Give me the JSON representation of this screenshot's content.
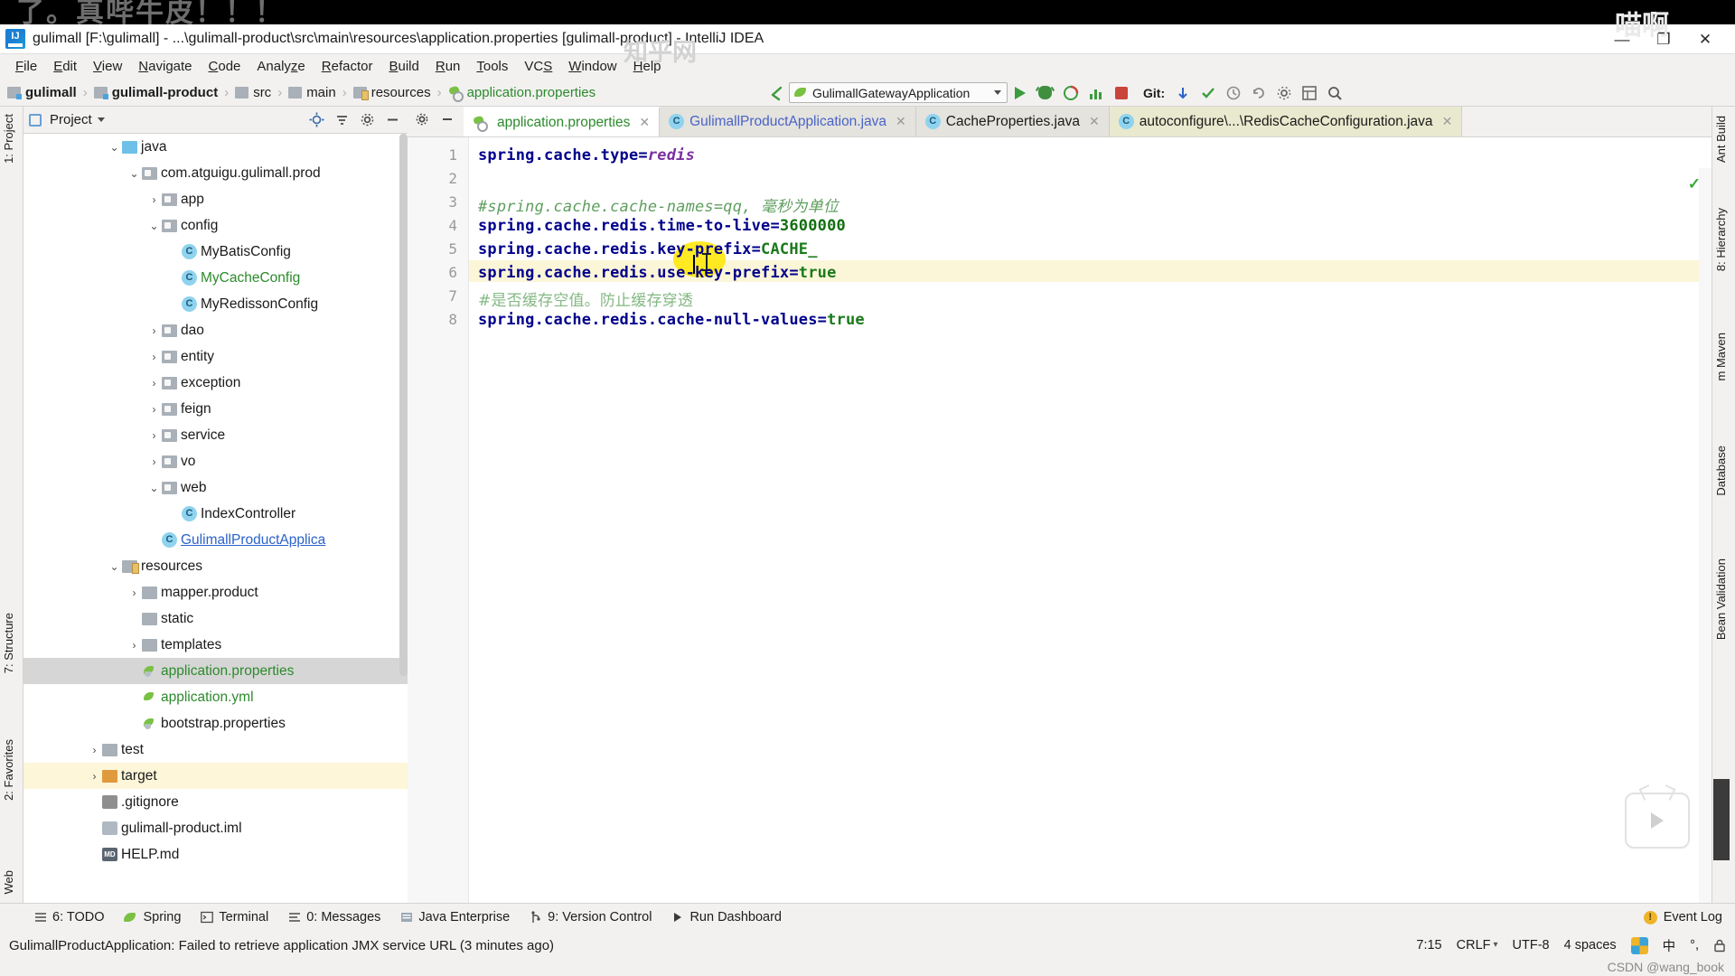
{
  "watermarks": {
    "top_left": "了。真哔牛皮！！！",
    "top_right": "喵啊",
    "mid": "知乎网",
    "csdn": "CSDN @wang_book"
  },
  "titlebar": {
    "title": "gulimall [F:\\gulimall] - ...\\gulimall-product\\src\\main\\resources\\application.properties [gulimall-product] - IntelliJ IDEA",
    "minimize": "—",
    "maximize": "❐",
    "close": "✕"
  },
  "menubar": {
    "items": [
      "File",
      "Edit",
      "View",
      "Navigate",
      "Code",
      "Analyze",
      "Refactor",
      "Build",
      "Run",
      "Tools",
      "VCS",
      "Window",
      "Help"
    ]
  },
  "breadcrumb": [
    {
      "label": "gulimall",
      "icon": "module-folder-icon",
      "bold": true
    },
    {
      "label": "gulimall-product",
      "icon": "module-folder-icon",
      "bold": true
    },
    {
      "label": "src",
      "icon": "folder-icon",
      "bold": false
    },
    {
      "label": "main",
      "icon": "folder-icon",
      "bold": false
    },
    {
      "label": "resources",
      "icon": "resources-folder-icon",
      "bold": false
    },
    {
      "label": "application.properties",
      "icon": "properties-file-icon",
      "bold": false,
      "green": true
    }
  ],
  "toolbar": {
    "run_config": "GulimallGatewayApplication",
    "git_label": "Git:",
    "icons": [
      "back-arrow-icon",
      "run-icon",
      "debug-icon",
      "run-coverage-icon",
      "profiler-icon",
      "stop-icon",
      "update-project-icon",
      "commit-icon",
      "history-icon",
      "revert-icon",
      "settings-icon",
      "project-structure-icon",
      "search-everywhere-icon"
    ]
  },
  "left_tool_strip": [
    {
      "label": "1: Project"
    },
    {
      "label": "2: Favorites"
    },
    {
      "label": "7: Structure"
    },
    {
      "label": "Web"
    }
  ],
  "right_tool_strip": [
    {
      "label": "Ant Build"
    },
    {
      "label": "8: Hierarchy"
    },
    {
      "label": "m  Maven"
    },
    {
      "label": "Database"
    },
    {
      "label": "Bean Validation"
    }
  ],
  "project_panel": {
    "title": "Project",
    "header_icons": [
      "project-select-icon",
      "chevron-down-icon",
      "locate-icon",
      "collapse-all-icon",
      "gear-icon",
      "hide-icon"
    ],
    "tree": [
      {
        "indent": 4,
        "arrow": "v",
        "icon": "folder-blue",
        "label": "java"
      },
      {
        "indent": 5,
        "arrow": "v",
        "icon": "package",
        "label": "com.atguigu.gulimall.prod"
      },
      {
        "indent": 6,
        "arrow": ">",
        "icon": "package",
        "label": "app"
      },
      {
        "indent": 6,
        "arrow": "v",
        "icon": "package",
        "label": "config"
      },
      {
        "indent": 7,
        "arrow": "",
        "icon": "class",
        "label": "MyBatisConfig"
      },
      {
        "indent": 7,
        "arrow": "",
        "icon": "class",
        "label": "MyCacheConfig",
        "color": "green"
      },
      {
        "indent": 7,
        "arrow": "",
        "icon": "class",
        "label": "MyRedissonConfig"
      },
      {
        "indent": 6,
        "arrow": ">",
        "icon": "package",
        "label": "dao"
      },
      {
        "indent": 6,
        "arrow": ">",
        "icon": "package",
        "label": "entity"
      },
      {
        "indent": 6,
        "arrow": ">",
        "icon": "package",
        "label": "exception"
      },
      {
        "indent": 6,
        "arrow": ">",
        "icon": "package",
        "label": "feign"
      },
      {
        "indent": 6,
        "arrow": ">",
        "icon": "package",
        "label": "service"
      },
      {
        "indent": 6,
        "arrow": ">",
        "icon": "package",
        "label": "vo"
      },
      {
        "indent": 6,
        "arrow": "v",
        "icon": "package",
        "label": "web"
      },
      {
        "indent": 7,
        "arrow": "",
        "icon": "class",
        "label": "IndexController"
      },
      {
        "indent": 6,
        "arrow": "",
        "icon": "spring-class",
        "label": "GulimallProductApplica",
        "color": "blue-u"
      },
      {
        "indent": 4,
        "arrow": "v",
        "icon": "folder-res",
        "label": "resources"
      },
      {
        "indent": 5,
        "arrow": ">",
        "icon": "folder",
        "label": "mapper.product"
      },
      {
        "indent": 5,
        "arrow": "",
        "icon": "folder",
        "label": "static"
      },
      {
        "indent": 5,
        "arrow": ">",
        "icon": "folder",
        "label": "templates"
      },
      {
        "indent": 5,
        "arrow": "",
        "icon": "properties-file",
        "label": "application.properties",
        "color": "green",
        "selected": true
      },
      {
        "indent": 5,
        "arrow": "",
        "icon": "yml-file",
        "label": "application.yml",
        "color": "green"
      },
      {
        "indent": 5,
        "arrow": "",
        "icon": "properties-file",
        "label": "bootstrap.properties"
      },
      {
        "indent": 3,
        "arrow": ">",
        "icon": "folder",
        "label": "test"
      },
      {
        "indent": 3,
        "arrow": ">",
        "icon": "folder-orange",
        "label": "target",
        "highlight": true
      },
      {
        "indent": 3,
        "arrow": "",
        "icon": "gitignore-file",
        "label": ".gitignore"
      },
      {
        "indent": 3,
        "arrow": "",
        "icon": "iml-file",
        "label": "gulimall-product.iml"
      },
      {
        "indent": 3,
        "arrow": "",
        "icon": "md-file",
        "label": "HELP.md"
      }
    ]
  },
  "editor": {
    "tabs": [
      {
        "label": "application.properties",
        "icon": "properties-file-icon",
        "active": true,
        "color": "green"
      },
      {
        "label": "GulimallProductApplication.java",
        "icon": "spring-class-icon",
        "active": false,
        "color": "blue"
      },
      {
        "label": "CacheProperties.java",
        "icon": "class-icon",
        "active": false,
        "color": "normal"
      },
      {
        "label": "autoconfigure\\...\\RedisCacheConfiguration.java",
        "icon": "class-icon",
        "active": false,
        "color": "normal",
        "olive": true
      }
    ],
    "line_numbers": [
      "1",
      "2",
      "3",
      "4",
      "5",
      "6",
      "7",
      "8"
    ],
    "lines": [
      {
        "n": 1,
        "segments": [
          {
            "t": "spring.cache.type=",
            "c": "k"
          },
          {
            "t": "redis",
            "c": "v-ital"
          }
        ]
      },
      {
        "n": 2,
        "segments": []
      },
      {
        "n": 3,
        "segments": [
          {
            "t": "#spring.cache.cache-names=qq, 毫秒为单位",
            "c": "cmt"
          }
        ]
      },
      {
        "n": 4,
        "segments": [
          {
            "t": "spring.cache.redis.time-to-live=",
            "c": "k"
          },
          {
            "t": "3600000",
            "c": "num"
          }
        ]
      },
      {
        "n": 5,
        "segments": [
          {
            "t": "spring.cache.redis.key-prefix=",
            "c": "k"
          },
          {
            "t": "CACHE_",
            "c": "strv"
          }
        ]
      },
      {
        "n": 6,
        "segments": [
          {
            "t": "spring.cache.redis.use-key-prefix=",
            "c": "k"
          },
          {
            "t": "true",
            "c": "strv"
          }
        ]
      },
      {
        "n": 7,
        "segments": [
          {
            "t": "#是否缓存空值。防止缓存穿透",
            "c": "cmt-cn"
          }
        ],
        "highlighted": true
      },
      {
        "n": 8,
        "segments": [
          {
            "t": "spring.cache.redis.cache-null-values=",
            "c": "k"
          },
          {
            "t": "true",
            "c": "strv"
          }
        ]
      }
    ],
    "inspection_status": "✓"
  },
  "bottom_toolbar": {
    "items": [
      {
        "label": "6: TODO",
        "icon": "todo-icon"
      },
      {
        "label": "Spring",
        "icon": "spring-icon"
      },
      {
        "label": "Terminal",
        "icon": "terminal-icon"
      },
      {
        "label": "0: Messages",
        "icon": "messages-icon"
      },
      {
        "label": "Java Enterprise",
        "icon": "java-enterprise-icon"
      },
      {
        "label": "9: Version Control",
        "icon": "version-control-icon"
      },
      {
        "label": "Run Dashboard",
        "icon": "run-dashboard-icon"
      }
    ],
    "event_log": "Event Log"
  },
  "statusbar": {
    "message": "GulimallProductApplication: Failed to retrieve application JMX service URL (3 minutes ago)",
    "caret_position": "7:15",
    "line_separator": "CRLF",
    "encoding": "UTF-8",
    "indent": "4 spaces",
    "ime": "中",
    "lock_icon": "lock-icon"
  }
}
